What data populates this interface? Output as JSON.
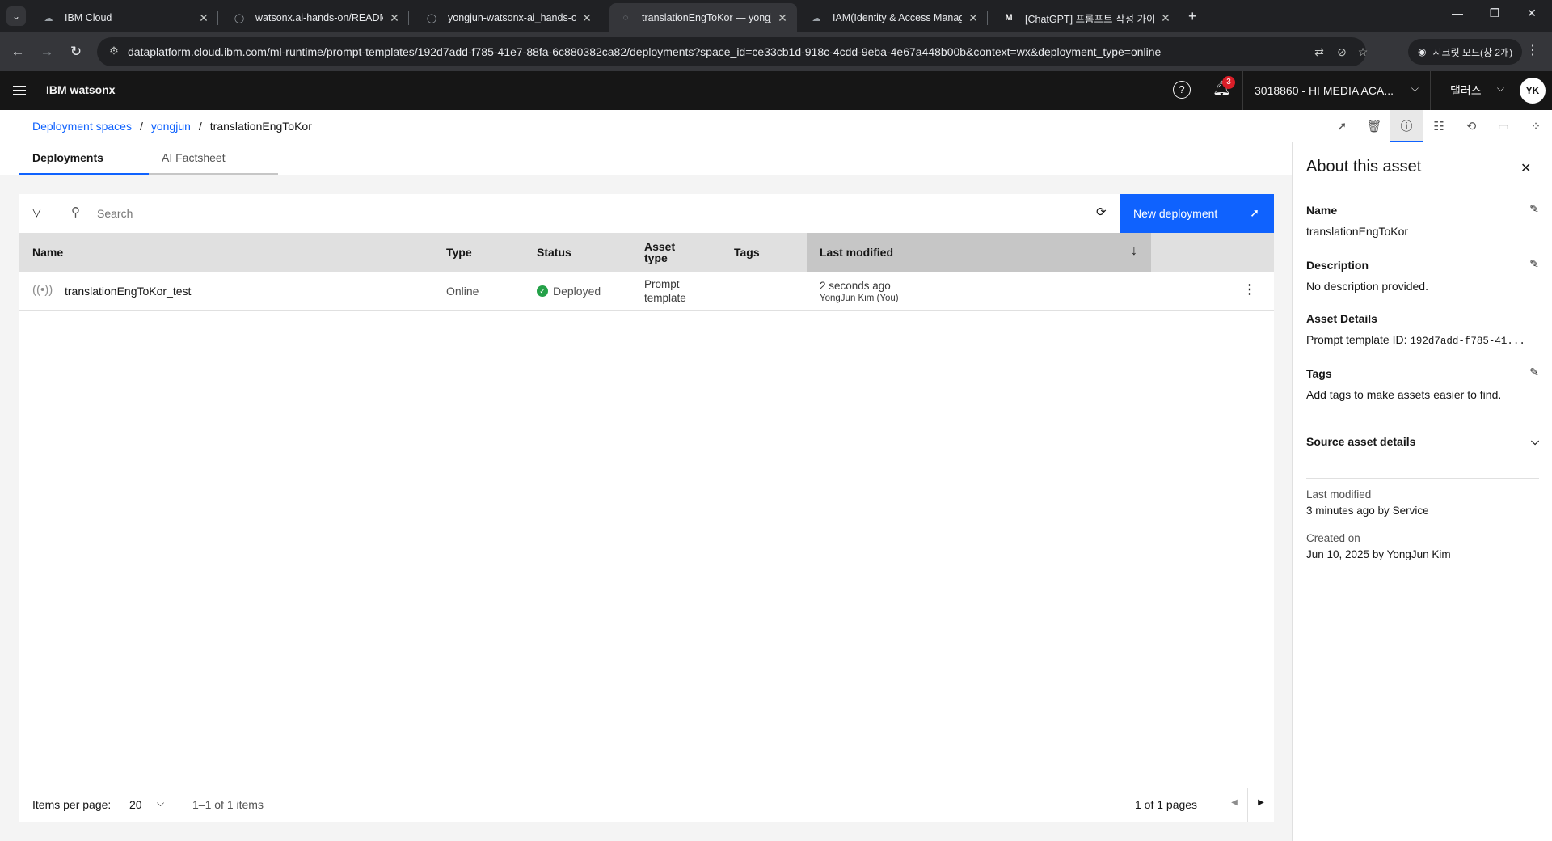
{
  "browser": {
    "tabs": [
      {
        "title": "IBM Cloud"
      },
      {
        "title": "watsonx.ai-hands-on/README"
      },
      {
        "title": "yongjun-watsonx-ai_hands-on"
      },
      {
        "title": "translationEngToKor — yongju"
      },
      {
        "title": "IAM(Identity & Access Manag"
      },
      {
        "title": "[ChatGPT] 프롬프트 작성 가이드"
      }
    ],
    "url": "dataplatform.cloud.ibm.com/ml-runtime/prompt-templates/192d7add-f785-41e7-88fa-6c880382ca82/deployments?space_id=ce33cb1d-918c-4cdd-9eba-4e67a448b00b&context=wx&deployment_type=online",
    "incognito_label": "시크릿 모드(창 2개)"
  },
  "header": {
    "title": "IBM watsonx",
    "notification_count": "3",
    "account": "3018860 - HI MEDIA ACA...",
    "region": "댈러스",
    "avatar_initials": "YK"
  },
  "breadcrumb": {
    "items": [
      "Deployment spaces",
      "yongjun",
      "translationEngToKor"
    ]
  },
  "tabs": [
    "Deployments",
    "AI Factsheet"
  ],
  "toolbar": {
    "search_placeholder": "Search",
    "new_deployment": "New deployment"
  },
  "table": {
    "columns": [
      "Name",
      "Type",
      "Status",
      "Asset type",
      "Tags",
      "Last modified"
    ],
    "rows": [
      {
        "name": "translationEngToKor_test",
        "type": "Online",
        "status": "Deployed",
        "asset_type_line1": "Prompt",
        "asset_type_line2": "template",
        "tags": "",
        "modified": "2 seconds ago",
        "modified_by": "YongJun Kim (You)"
      }
    ]
  },
  "pagination": {
    "items_per_page_label": "Items per page:",
    "items_per_page": "20",
    "range": "1–1 of 1 items",
    "pages": "1 of 1 pages"
  },
  "panel": {
    "title": "About this asset",
    "name_label": "Name",
    "name_value": "translationEngToKor",
    "description_label": "Description",
    "description_value": "No description provided.",
    "asset_details_label": "Asset Details",
    "prompt_id_label": "Prompt template ID:",
    "prompt_id_value": "192d7add-f785-41...",
    "tags_label": "Tags",
    "tags_value": "Add tags to make assets easier to find.",
    "source_label": "Source asset details",
    "last_modified_label": "Last modified",
    "last_modified_value": "3 minutes ago by Service",
    "created_label": "Created on",
    "created_value": "Jun 10, 2025 by YongJun Kim"
  },
  "colors": {
    "accent": "#0f62fe",
    "status_ok": "#24a148",
    "header_bg": "#161616",
    "badge": "#da1e28"
  }
}
